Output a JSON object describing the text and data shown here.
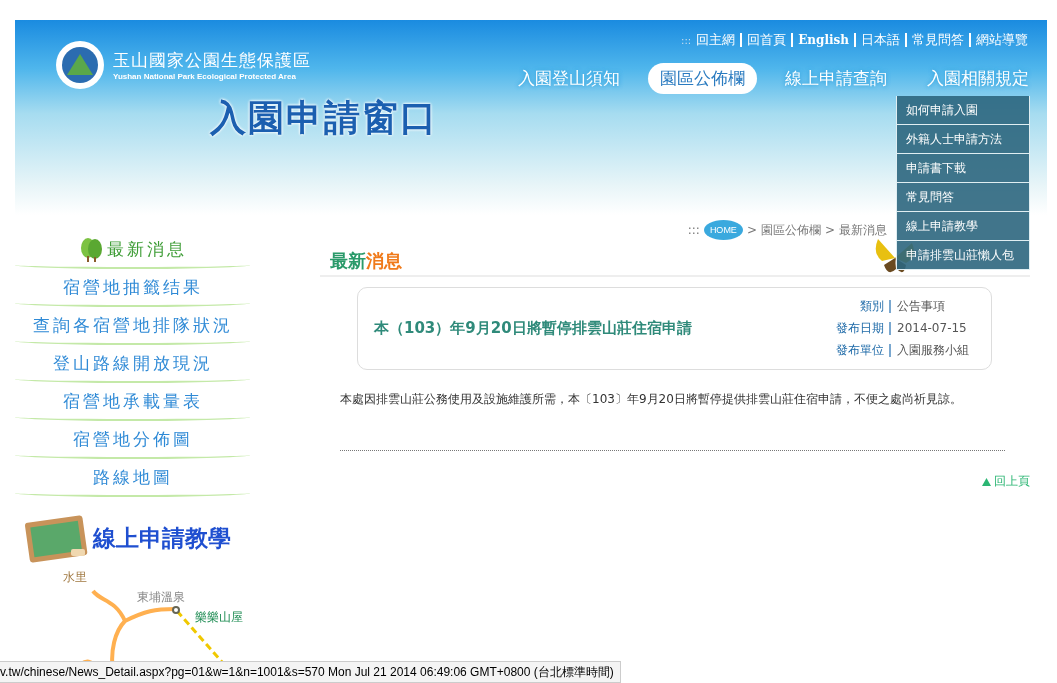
{
  "header": {
    "logo_title": "玉山國家公園生態保護區",
    "logo_subtitle": "Yushan National Park Ecological Protected Area",
    "banner_title": "入園申請窗口"
  },
  "top_links": {
    "prefix": ":::",
    "items": [
      "回主網",
      "回首頁",
      "English",
      "日本語",
      "常見問答",
      "網站導覽"
    ]
  },
  "main_nav": [
    {
      "label": "入園登山須知",
      "selected": false
    },
    {
      "label": "園區公佈欄",
      "selected": true
    },
    {
      "label": "線上申請查詢",
      "selected": false
    },
    {
      "label": "入園相關規定",
      "selected": false
    }
  ],
  "dropdown": {
    "items": [
      "如何申請入園",
      "外籍人士申請方法",
      "申請書下載",
      "常見問答",
      "線上申請教學",
      "申請排雲山莊懶人包"
    ]
  },
  "breadcrumb": [
    {
      "kind": "prefix",
      "label": ":::"
    },
    {
      "kind": "home",
      "label": "HOME"
    },
    {
      "kind": "separator",
      "label": ">"
    },
    {
      "kind": "link",
      "label": "園區公佈欄"
    },
    {
      "kind": "separator",
      "label": ">"
    },
    {
      "kind": "link",
      "label": "最新消息"
    }
  ],
  "sidebar": {
    "items": [
      {
        "label": "最新消息",
        "selected": true
      },
      {
        "label": "宿營地抽籤结果",
        "selected": false
      },
      {
        "label": "查詢各宿營地排隊狀況",
        "selected": false
      },
      {
        "label": "登山路線開放現況",
        "selected": false
      },
      {
        "label": "宿營地承載量表",
        "selected": false
      },
      {
        "label": "宿營地分佈圖",
        "selected": false
      },
      {
        "label": "路線地圖",
        "selected": false
      }
    ]
  },
  "tutorial_banner": "線上申請教學",
  "map": {
    "labels": [
      "水里",
      "東埔溫泉",
      "樂樂山屋"
    ]
  },
  "section_title": {
    "lead": "最新",
    "rest": "消息"
  },
  "article": {
    "title": "本（103）年9月20日將暫停排雲山莊住宿申請",
    "meta": [
      {
        "label": "類別",
        "value": "公告事項"
      },
      {
        "label": "發布日期",
        "value": "2014-07-15"
      },
      {
        "label": "發布單位",
        "value": "入園服務小組"
      }
    ],
    "body": "本處因排雲山莊公務使用及設施維護所需，本〔103〕年9月20日將暫停提供排雲山莊住宿申請，不便之處尚祈見諒。",
    "back_to_top": "回上頁"
  },
  "status_bar": "v.tw/chinese/News_Detail.aspx?pg=01&w=1&n=1001&s=570 Mon Jul 21 2014 06:49:06 GMT+0800 (台北標準時間)"
}
